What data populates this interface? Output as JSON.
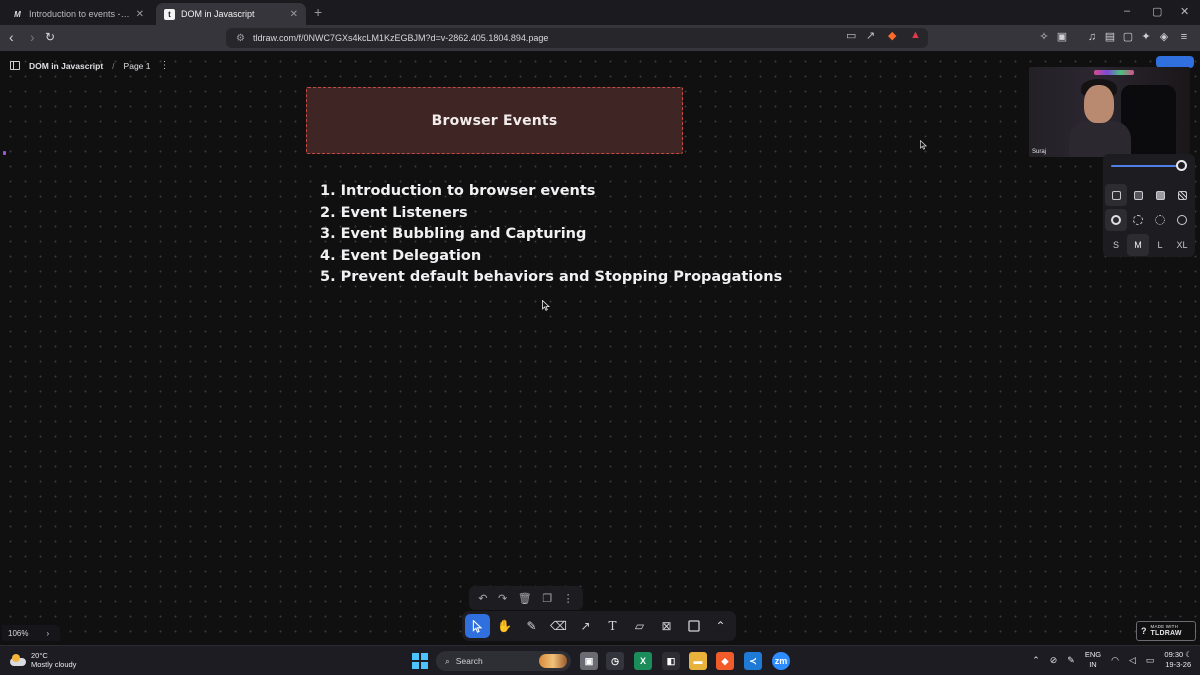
{
  "browser": {
    "tabs": [
      {
        "title": "Introduction to events - Learn web d",
        "favicon": "M",
        "active": false
      },
      {
        "title": "DOM in Javascript",
        "favicon": "tldraw",
        "active": true
      }
    ],
    "new_tab_label": "+",
    "window_controls": [
      "–",
      "▢",
      "✕"
    ],
    "url": "tldraw.com/f/0NWC7GXs4kcLM1KzEGBJM?d=v-2862.405.1804.894.page"
  },
  "app": {
    "doc_name": "DOM in Javascript",
    "separator": "/",
    "page_name": "Page 1",
    "zoom": "106%",
    "made_with": {
      "line1": "MADE WITH",
      "line2": "TLDRAW"
    }
  },
  "canvas": {
    "title_box": "Browser Events",
    "items": [
      "1. Introduction to browser events",
      "2. Event Listeners",
      "3. Event Bubbling and Capturing",
      "4. Event Delegation",
      "5. Prevent default behaviors and Stopping Propagations"
    ]
  },
  "webcam": {
    "name": "Suraj"
  },
  "style_panel": {
    "opacity": 1.0,
    "sizes": [
      "S",
      "M",
      "L",
      "XL"
    ],
    "selected_size": "M"
  },
  "toolbar": {
    "tools": [
      "select",
      "hand",
      "draw",
      "eraser",
      "arrow",
      "text",
      "note",
      "asset",
      "rectangle",
      "more"
    ],
    "selected_tool": "select"
  },
  "taskbar": {
    "weather_temp": "20°C",
    "weather_desc": "Mostly cloudy",
    "search_label": "Search",
    "lang_1": "ENG",
    "lang_2": "IN",
    "time": "09:30",
    "date": "19-3-26"
  },
  "colors": {
    "accent": "#2f6fde",
    "title_box_fill": "#3f2624",
    "title_box_border": "#c54844",
    "canvas_bg": "#101011"
  }
}
